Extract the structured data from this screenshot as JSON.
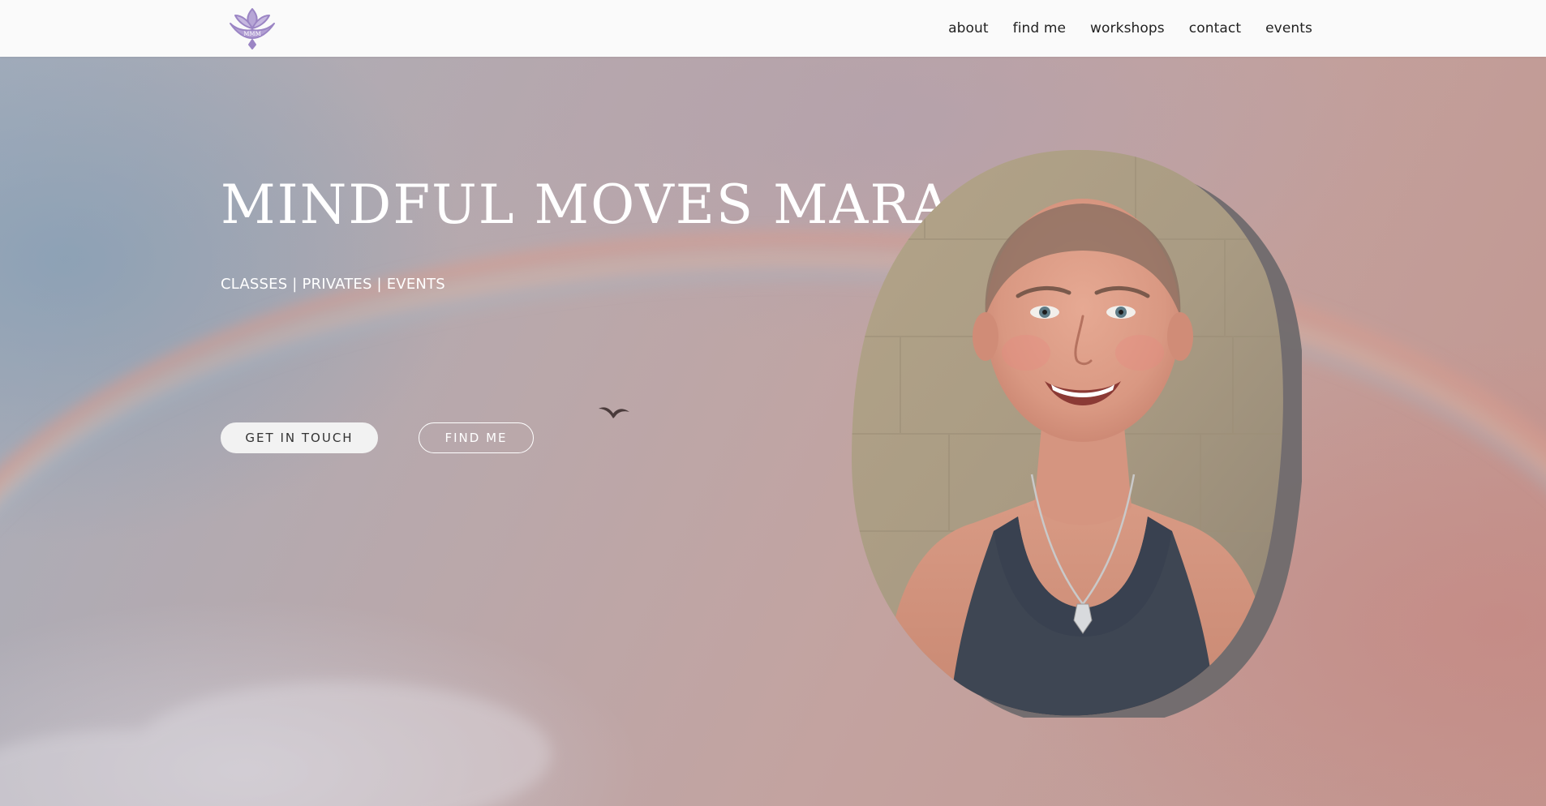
{
  "header": {
    "logo_icon": "lotus-logo-icon",
    "logo_text": "MMM",
    "nav": [
      {
        "label": "about"
      },
      {
        "label": "find me"
      },
      {
        "label": "workshops"
      },
      {
        "label": "contact"
      },
      {
        "label": "events"
      }
    ]
  },
  "hero": {
    "title": "MINDFUL MOVES MARA",
    "tagline": "CLASSES | PRIVATES | EVENTS",
    "primary_button": "GET IN TOUCH",
    "secondary_button": "FIND ME",
    "background": "rainbow-sky-photo",
    "decoration_icon": "bird-icon",
    "portrait": "portrait-photo"
  },
  "colors": {
    "header_bg": "#fafafa",
    "logo_accent": "#9b85c4",
    "hero_text": "#ffffff",
    "nav_text": "#222222",
    "primary_button_bg": "#f2f2f2"
  }
}
